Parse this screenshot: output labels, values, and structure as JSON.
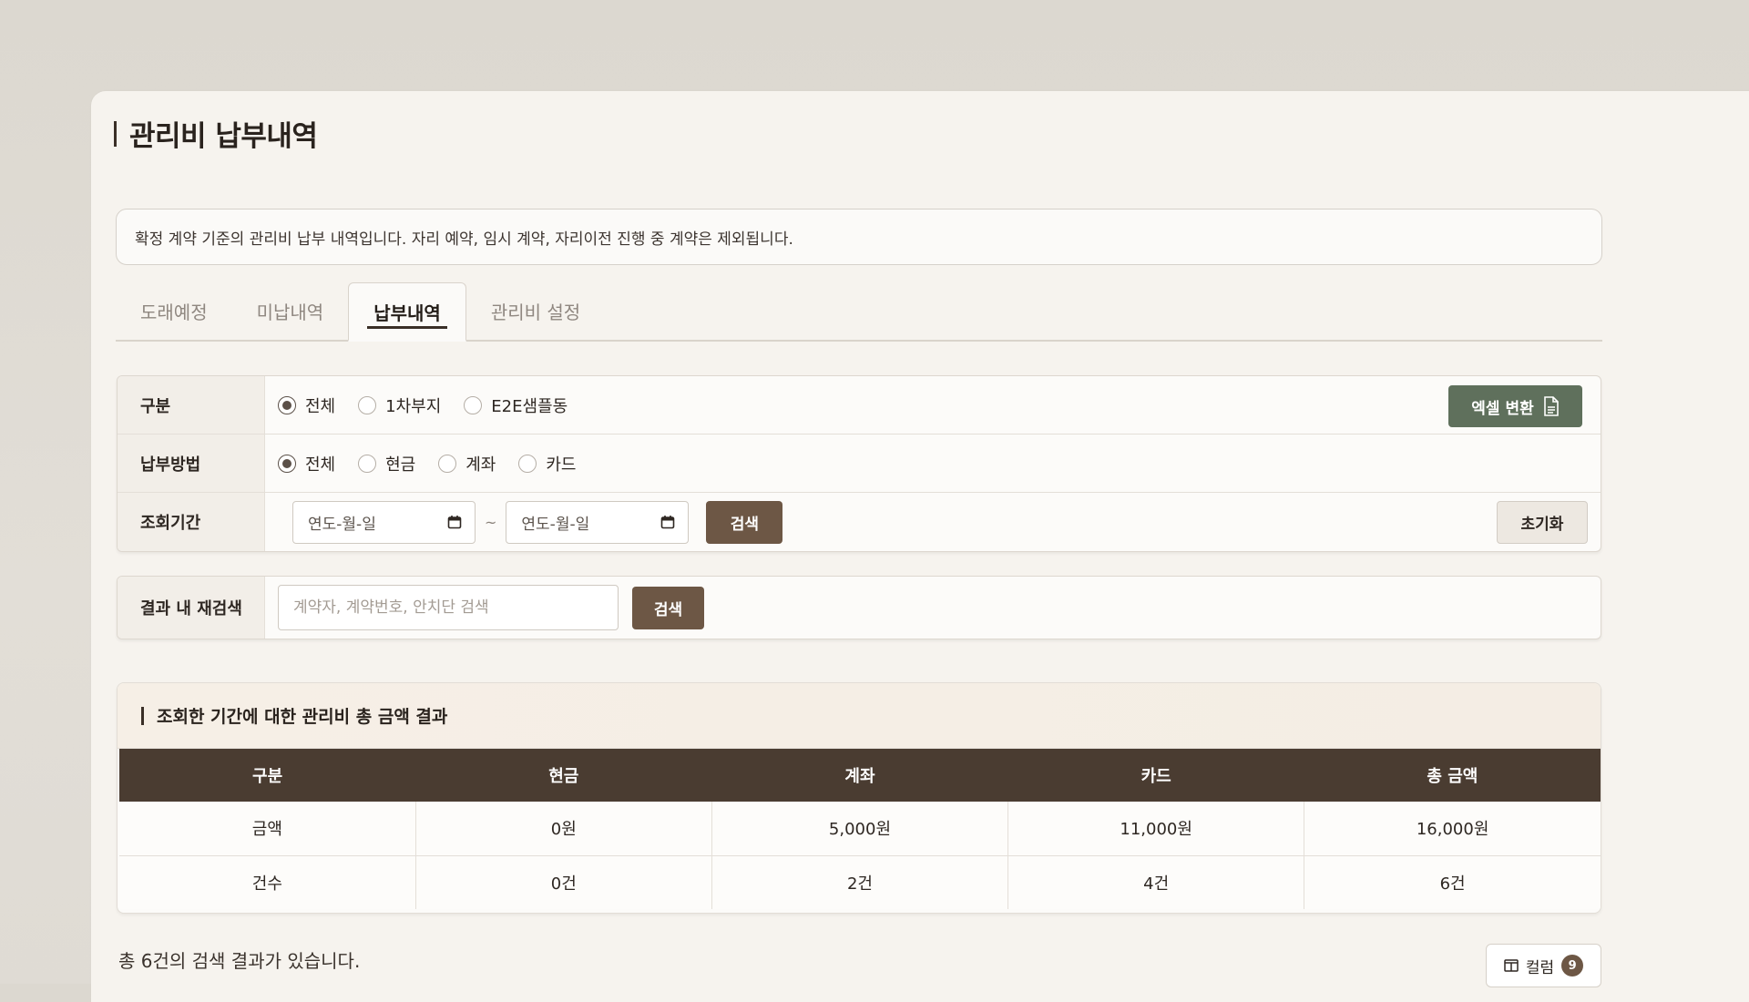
{
  "page": {
    "title": "관리비 납부내역"
  },
  "notice": {
    "text": "확정 계약 기준의 관리비 납부 내역입니다. 자리 예약, 임시 계약, 자리이전 진행 중 계약은 제외됩니다."
  },
  "tabs": [
    {
      "label": "도래예정",
      "active": false
    },
    {
      "label": "미납내역",
      "active": false
    },
    {
      "label": "납부내역",
      "active": true
    },
    {
      "label": "관리비 설정",
      "active": false
    }
  ],
  "filters": {
    "category": {
      "label": "구분",
      "options": [
        {
          "label": "전체",
          "checked": true
        },
        {
          "label": "1차부지",
          "checked": false
        },
        {
          "label": "E2E샘플동",
          "checked": false
        }
      ],
      "excel_button": "엑셀 변환"
    },
    "method": {
      "label": "납부방법",
      "options": [
        {
          "label": "전체",
          "checked": true
        },
        {
          "label": "현금",
          "checked": false
        },
        {
          "label": "계좌",
          "checked": false
        },
        {
          "label": "카드",
          "checked": false
        }
      ]
    },
    "period": {
      "label": "조회기간",
      "start_placeholder": "연도-월-일",
      "end_placeholder": "연도-월-일",
      "separator": "~",
      "search_button": "검색",
      "reset_button": "초기화"
    }
  },
  "research": {
    "label": "결과 내 재검색",
    "placeholder": "계약자, 계약번호, 안치단 검색",
    "search_button": "검색"
  },
  "summary": {
    "title": "조회한 기간에 대한 관리비 총 금액 결과",
    "headers": [
      "구분",
      "현금",
      "계좌",
      "카드",
      "총 금액"
    ],
    "rows": [
      [
        "금액",
        "0원",
        "5,000원",
        "11,000원",
        "16,000원"
      ],
      [
        "건수",
        "0건",
        "2건",
        "4건",
        "6건"
      ]
    ]
  },
  "results": {
    "count_text": "총 6건의 검색 결과가 있습니다.",
    "column_button": "컬럼",
    "column_count": "9"
  }
}
